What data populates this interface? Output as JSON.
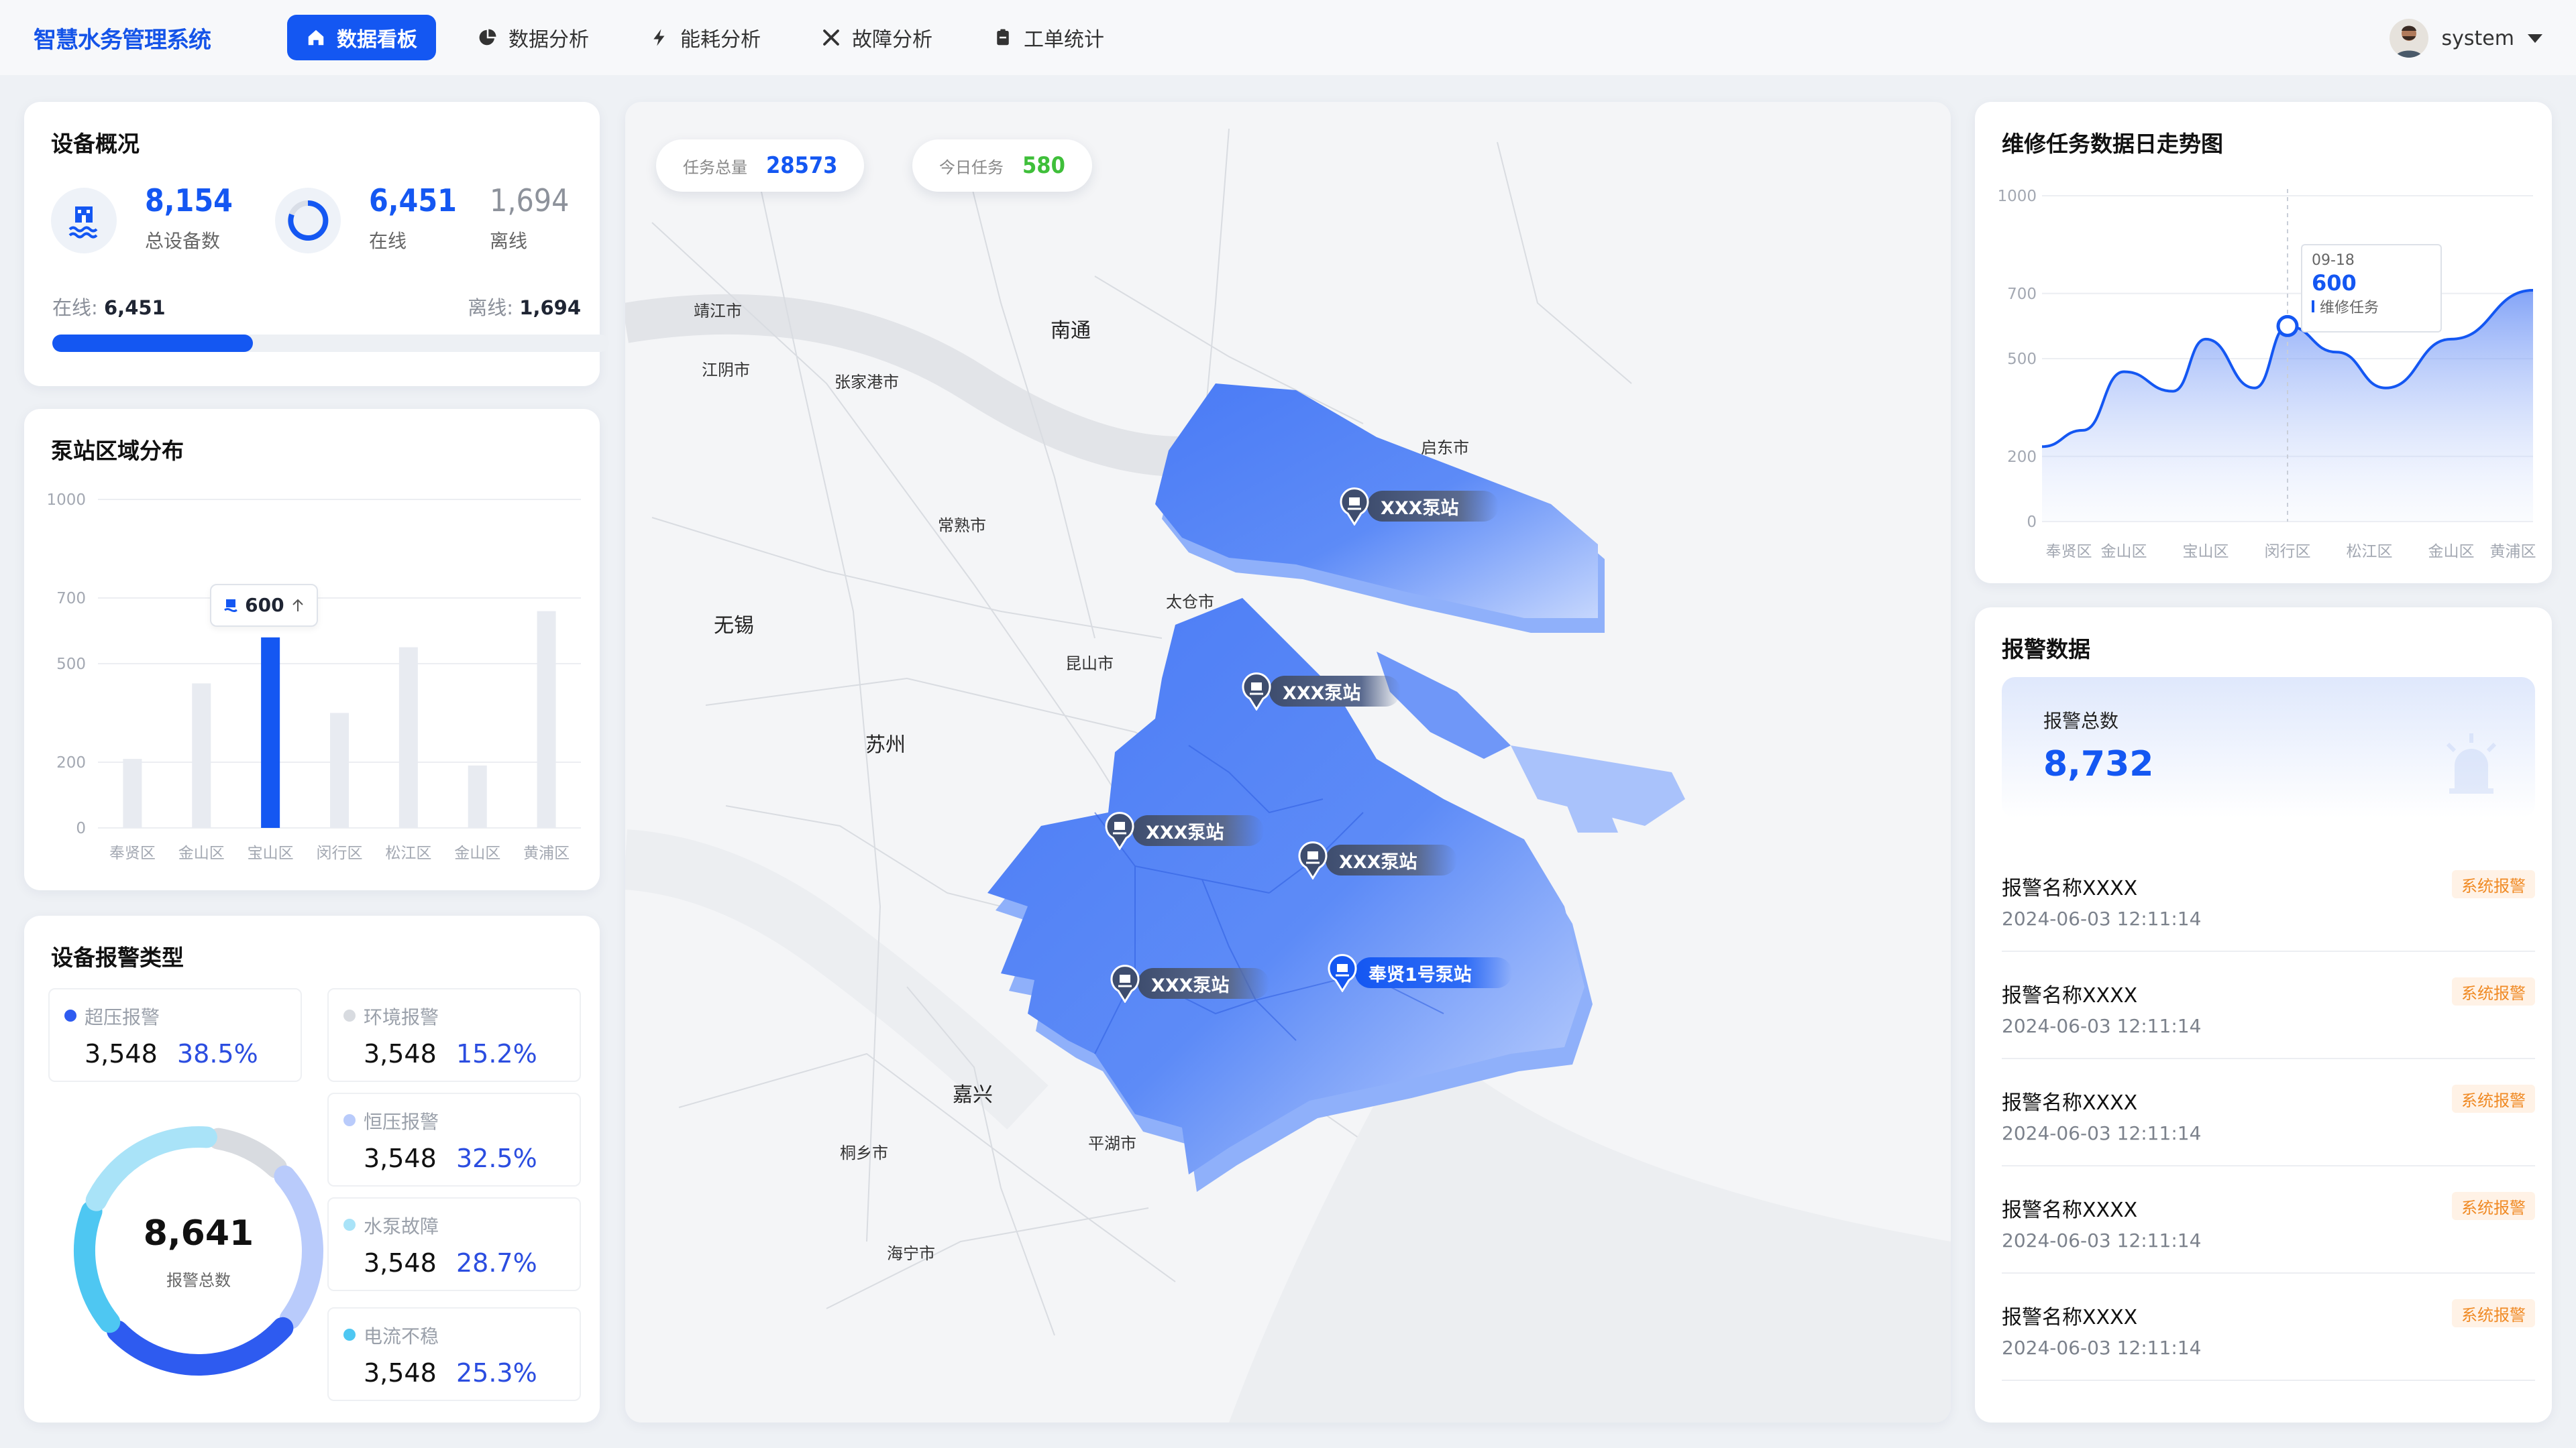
{
  "app": {
    "title": "智慧水务管理系统"
  },
  "nav": [
    {
      "label": "数据看板",
      "icon": "home-icon",
      "active": true
    },
    {
      "label": "数据分析",
      "icon": "pie-chart-icon",
      "active": false
    },
    {
      "label": "能耗分析",
      "icon": "lightning-icon",
      "active": false
    },
    {
      "label": "故障分析",
      "icon": "tools-icon",
      "active": false
    },
    {
      "label": "工单统计",
      "icon": "clipboard-icon",
      "active": false
    }
  ],
  "user": {
    "name": "system"
  },
  "overview": {
    "title": "设备概况",
    "total": "8,154",
    "total_label": "总设备数",
    "online": "6,451",
    "online_label": "在线",
    "offline": "1,694",
    "offline_label": "离线",
    "online_text": "在线:",
    "online_value": "6,451",
    "offline_text": "离线:",
    "offline_value": "1,694",
    "online_ratio": 0.36
  },
  "pump_distribution": {
    "title": "泵站区域分布",
    "tooltip": "600"
  },
  "alarm_types": {
    "title": "设备报警类型",
    "total": "8,641",
    "total_label": "报警总数",
    "items": [
      {
        "name": "超压报警",
        "count": "3,548",
        "pct": "38.5%",
        "color": "#2e5bf0"
      },
      {
        "name": "环境报警",
        "count": "3,548",
        "pct": "15.2%",
        "color": "#d8dbe0"
      },
      {
        "name": "恒压报警",
        "count": "3,548",
        "pct": "32.5%",
        "color": "#b9cbfb"
      },
      {
        "name": "水泵故障",
        "count": "3,548",
        "pct": "28.7%",
        "color": "#a9e3f8"
      },
      {
        "name": "电流不稳",
        "count": "3,548",
        "pct": "25.3%",
        "color": "#4ec7f2"
      }
    ]
  },
  "map": {
    "task_total_label": "任务总量",
    "task_total": "28573",
    "today_label": "今日任务",
    "today": "580",
    "cities": [
      "靖江市",
      "南通",
      "江阴市",
      "张家港市",
      "启东市",
      "常熟市",
      "太仓市",
      "无锡",
      "昆山市",
      "苏州",
      "嘉兴",
      "平湖市",
      "桐乡市",
      "海宁市"
    ],
    "stations": [
      "XXX泵站",
      "XXX泵站",
      "XXX泵站",
      "XXX泵站",
      "XXX泵站",
      "奉贤1号泵站"
    ]
  },
  "repair_trend": {
    "title": "维修任务数据日走势图",
    "tooltip_date": "09-18",
    "tooltip_value": "600",
    "tooltip_series": "维修任务"
  },
  "alarm_data": {
    "title": "报警数据",
    "total_label": "报警总数",
    "total": "8,732",
    "rows": [
      {
        "name": "报警名称XXXX",
        "time": "2024-06-03 12:11:14",
        "badge": "系统报警"
      },
      {
        "name": "报警名称XXXX",
        "time": "2024-06-03 12:11:14",
        "badge": "系统报警"
      },
      {
        "name": "报警名称XXXX",
        "time": "2024-06-03 12:11:14",
        "badge": "系统报警"
      },
      {
        "name": "报警名称XXXX",
        "time": "2024-06-03 12:11:14",
        "badge": "系统报警"
      },
      {
        "name": "报警名称XXXX",
        "time": "2024-06-03 12:11:14",
        "badge": "系统报警"
      }
    ]
  },
  "colors": {
    "accent": "#1457f2",
    "green": "#3fbf3a",
    "warn": "#f08a24"
  },
  "chart_data": [
    {
      "type": "bar",
      "title": "泵站区域分布",
      "categories": [
        "奉贤区",
        "金山区",
        "宝山区",
        "闵行区",
        "松江区",
        "金山区",
        "黄浦区"
      ],
      "values": [
        210,
        440,
        580,
        350,
        550,
        190,
        660
      ],
      "ylim": [
        0,
        1000
      ],
      "yticks": [
        0,
        200,
        500,
        700,
        1000
      ],
      "highlight_index": 2
    },
    {
      "type": "area",
      "title": "维修任务数据日走势图",
      "categories": [
        "奉贤区",
        "金山区",
        "宝山区",
        "闵行区",
        "松江区",
        "金山区",
        "黄浦区"
      ],
      "ylim": [
        0,
        1000
      ],
      "yticks": [
        0,
        200,
        500,
        700,
        1000
      ],
      "series": [
        {
          "name": "维修任务",
          "values": [
            230,
            280,
            460,
            400,
            560,
            410,
            600,
            520,
            410,
            560,
            710
          ]
        }
      ],
      "x": [
        0,
        0.5,
        1,
        1.6,
        2,
        2.6,
        3,
        3.6,
        4.2,
        5,
        6
      ]
    },
    {
      "type": "pie",
      "title": "设备报警类型",
      "total": "8,641",
      "slices": [
        {
          "name": "超压报警",
          "value": 38.5,
          "color": "#2e5bf0"
        },
        {
          "name": "环境报警",
          "value": 15.2,
          "color": "#d8dbe0"
        },
        {
          "name": "恒压报警",
          "value": 32.5,
          "color": "#b9cbfb"
        },
        {
          "name": "水泵故障",
          "value": 28.7,
          "color": "#a9e3f8"
        },
        {
          "name": "电流不稳",
          "value": 25.3,
          "color": "#4ec7f2"
        }
      ]
    }
  ]
}
